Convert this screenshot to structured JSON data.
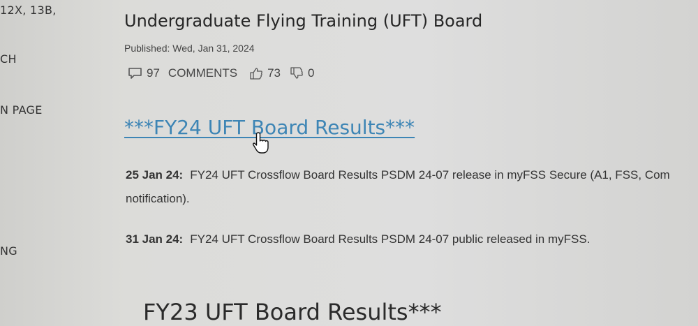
{
  "sidebar": {
    "items": [
      {
        "label": "12X, 13B,"
      },
      {
        "label": "CH"
      },
      {
        "label": "N PAGE"
      },
      {
        "label": "NG"
      }
    ]
  },
  "article": {
    "title": "Undergraduate Flying Training (UFT) Board",
    "published": "Published: Wed, Jan 31, 2024",
    "comments_count": "97",
    "comments_label": "COMMENTS",
    "likes": "73",
    "dislikes": "0",
    "results_link": "***FY24 UFT Board Results***",
    "entries": [
      {
        "date": "25 Jan 24:",
        "text": "FY24 UFT Crossflow Board Results PSDM 24-07 release in myFSS Secure (A1, FSS, Com",
        "continuation": "notification)."
      },
      {
        "date": "31 Jan 24:",
        "text": "FY24 UFT Crossflow Board Results PSDM 24-07 public released in myFSS."
      }
    ],
    "next_heading": "FY23 UFT Board Results***"
  },
  "icons": {
    "comment": "comment-icon",
    "like": "thumbs-up-icon",
    "dislike": "thumbs-down-icon",
    "cursor": "hand-pointer-icon"
  },
  "colors": {
    "link": "#3d85b5",
    "text": "#333333",
    "background": "#dcdcd9"
  }
}
